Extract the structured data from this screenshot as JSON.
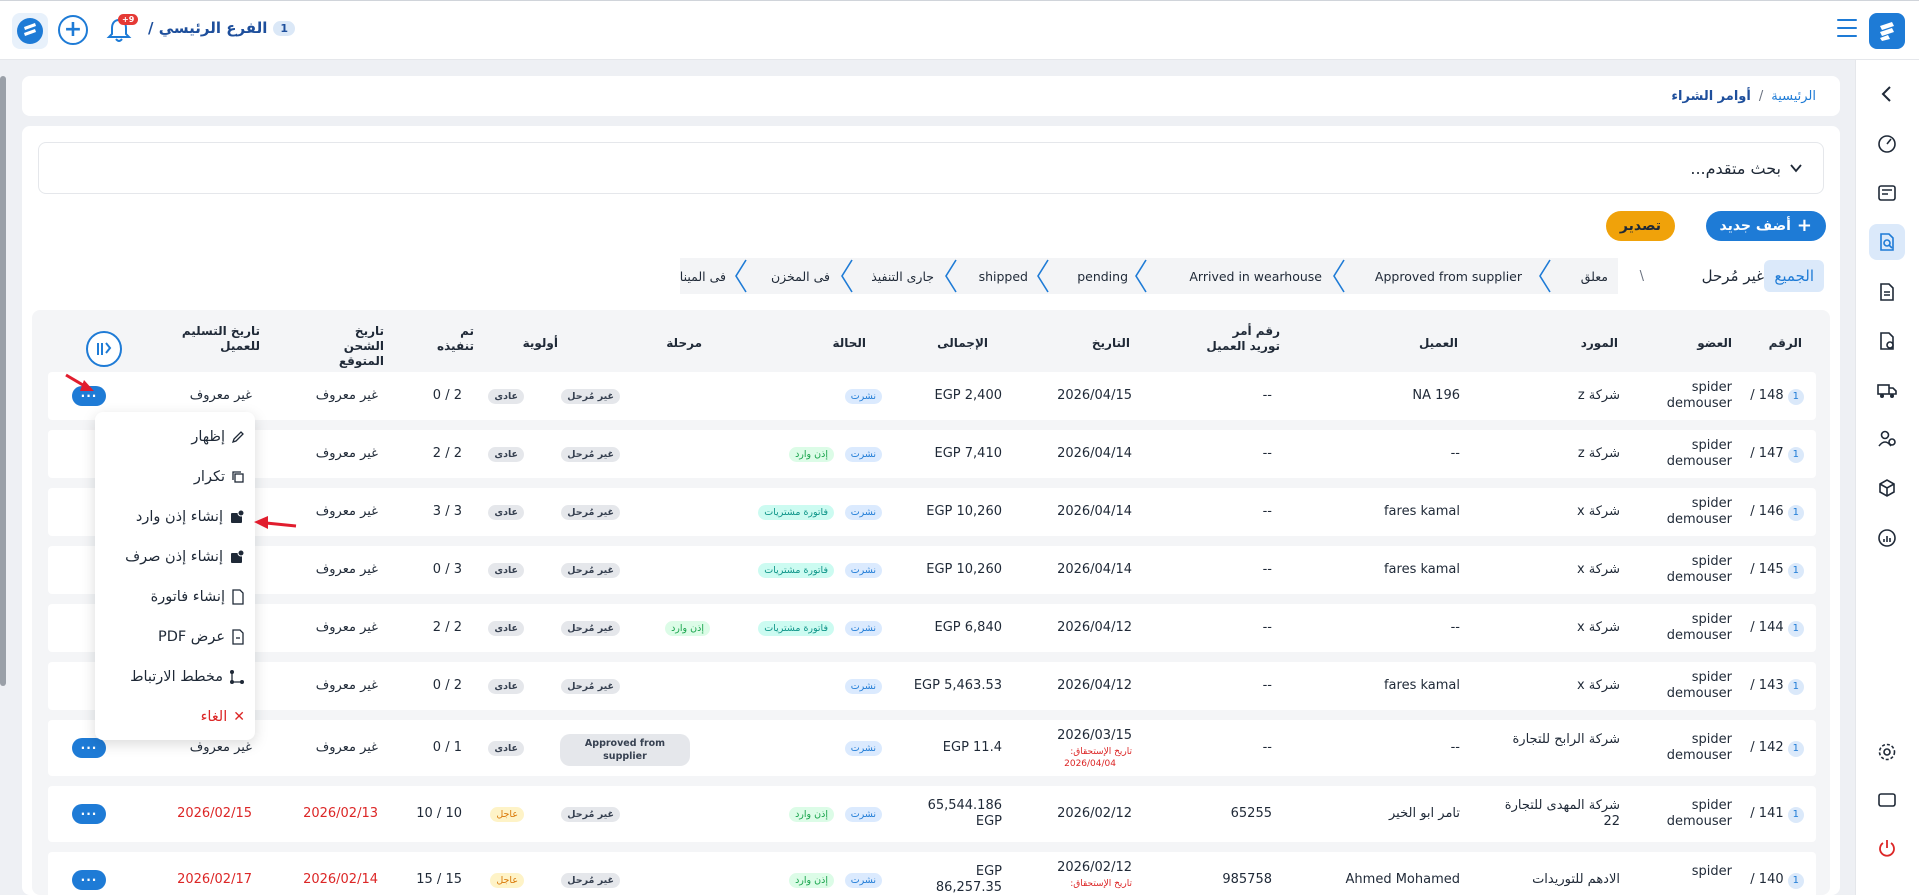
{
  "header": {
    "branch_name": "الفرع الرئيسي /",
    "branch_number": "1",
    "notifications_count": "+9"
  },
  "breadcrumb": {
    "home": "الرئيسية",
    "separator": "/",
    "current": "أوامر الشراء"
  },
  "search": {
    "label": "بحث متقدم..."
  },
  "actions": {
    "add_new": "أضف جديد",
    "export": "تصدير"
  },
  "filters": {
    "all": "الجميع",
    "unposted": "غير مُرحل",
    "slash": "\\",
    "stages": [
      "معلق",
      "Approved from supplier",
      "Arrived in wearhouse",
      "pending",
      "shipped",
      "جارى التنفيذ",
      "فى المخزن",
      "فى المينا"
    ]
  },
  "table": {
    "headers": {
      "number": "الرقم",
      "member": "العضو",
      "supplier": "المورد",
      "client": "العميل",
      "client_po": "رقم أمر توريد العميل",
      "date": "التاريخ",
      "total": "الإجمالى",
      "status": "الحالة",
      "stage": "مرحلة",
      "priority": "أولوية",
      "executed": "تم تنفيذه",
      "expected_ship": "تاريخ الشحن المتوقع",
      "client_delivery": "تاريخ التسليم للعميل"
    },
    "rows": [
      {
        "num": "148 /",
        "chip": "1",
        "member": "spider demouser",
        "supplier": "شركة z",
        "client": "NA 196",
        "po": "--",
        "date": "2026/04/15",
        "due_label": "",
        "due_date": "",
        "total": "EGP 2,400",
        "status": "نشرت",
        "tags": [],
        "stage": "غير مُرحل",
        "priority": "عادى",
        "executed": "2 / 0",
        "ship": "غير معروف",
        "delivery": "غير معروف"
      },
      {
        "num": "147 /",
        "chip": "1",
        "member": "spider demouser",
        "supplier": "شركة z",
        "client": "--",
        "po": "--",
        "date": "2026/04/14",
        "due_label": "",
        "due_date": "",
        "total": "EGP 7,410",
        "status": "نشرت",
        "tags": [
          "إذن وارد"
        ],
        "stage": "غير مُرحل",
        "priority": "عادى",
        "executed": "2 / 2",
        "ship": "غير معروف",
        "delivery": ""
      },
      {
        "num": "146 /",
        "chip": "1",
        "member": "spider demouser",
        "supplier": "شركة x",
        "client": "fares kamal",
        "po": "--",
        "date": "2026/04/14",
        "due_label": "",
        "due_date": "",
        "total": "EGP 10,260",
        "status": "نشرت",
        "tags": [
          "فاتورة مشتريات"
        ],
        "stage": "غير مُرحل",
        "priority": "عادى",
        "executed": "3 / 3",
        "ship": "غير معروف",
        "delivery": ""
      },
      {
        "num": "145 /",
        "chip": "1",
        "member": "spider demouser",
        "supplier": "شركة x",
        "client": "fares kamal",
        "po": "--",
        "date": "2026/04/14",
        "due_label": "",
        "due_date": "",
        "total": "EGP 10,260",
        "status": "نشرت",
        "tags": [
          "فاتورة مشتريات"
        ],
        "stage": "غير مُرحل",
        "priority": "عادى",
        "executed": "3 / 0",
        "ship": "غير معروف",
        "delivery": ""
      },
      {
        "num": "144 /",
        "chip": "1",
        "member": "spider demouser",
        "supplier": "شركة x",
        "client": "--",
        "po": "--",
        "date": "2026/04/12",
        "due_label": "",
        "due_date": "",
        "total": "EGP 6,840",
        "status": "نشرت",
        "tags": [
          "فاتورة مشتريات",
          "إذن وارد"
        ],
        "stage": "غير مُرحل",
        "priority": "عادى",
        "executed": "2 / 2",
        "ship": "غير معروف",
        "delivery": ""
      },
      {
        "num": "143 /",
        "chip": "1",
        "member": "spider demouser",
        "supplier": "شركة x",
        "client": "fares kamal",
        "po": "--",
        "date": "2026/04/12",
        "due_label": "",
        "due_date": "",
        "total": "EGP 5,463.53",
        "status": "نشرت",
        "tags": [],
        "stage": "غير مُرحل",
        "priority": "عادى",
        "executed": "2 / 0",
        "ship": "غير معروف",
        "delivery": ""
      },
      {
        "num": "142 /",
        "chip": "1",
        "member": "spider demouser",
        "supplier": "شركة الرابح للتجارة",
        "client": "--",
        "po": "--",
        "date": "2026/03/15",
        "due_label": "تاريخ الإستحقاق:",
        "due_date": "2026/04/04",
        "total": "EGP 11.4",
        "status": "نشرت",
        "tags": [],
        "stage": "Approved from supplier",
        "priority": "عادى",
        "executed": "1 / 0",
        "ship": "غير معروف",
        "delivery": "غير معروف"
      },
      {
        "num": "141 /",
        "chip": "1",
        "member": "spider demouser",
        "supplier": "شركة المهدى للتجارة 22",
        "client": "تامر ابو الخير",
        "po": "65255",
        "date": "2026/02/12",
        "due_label": "",
        "due_date": "",
        "total": "65,544.186 EGP",
        "status": "نشرت",
        "tags": [
          "إذن وارد"
        ],
        "stage": "غير مُرحل",
        "priority": "عاجل",
        "executed": "10 / 10",
        "ship": "2026/02/13",
        "delivery": "2026/02/15"
      },
      {
        "num": "140 /",
        "chip": "1",
        "member": "spider",
        "supplier": "الادهم للتوريدات",
        "client": "Ahmed Mohamed",
        "po": "985758",
        "date": "2026/02/12",
        "due_label": "تاريخ الإستحقاق:",
        "due_date": "",
        "total": "EGP 86,257.35",
        "status": "نشرت",
        "tags": [
          "إذن وارد"
        ],
        "stage": "غير مُرحل",
        "priority": "عاجل",
        "executed": "15 / 15",
        "ship": "2026/02/14",
        "delivery": "2026/02/17"
      }
    ]
  },
  "row_menu": {
    "items": [
      "إظهار",
      "تكرار",
      "إنشاء إذن وارد",
      "إنشاء إذن صرف",
      "إنشاء فاتورة",
      "عرض PDF",
      "مخطط الارتباط"
    ],
    "cancel": "الغاء"
  },
  "more_label": "···",
  "colors": {
    "primary": "#1e7bd6",
    "accent": "#f0a20a",
    "danger": "#dc2626"
  }
}
